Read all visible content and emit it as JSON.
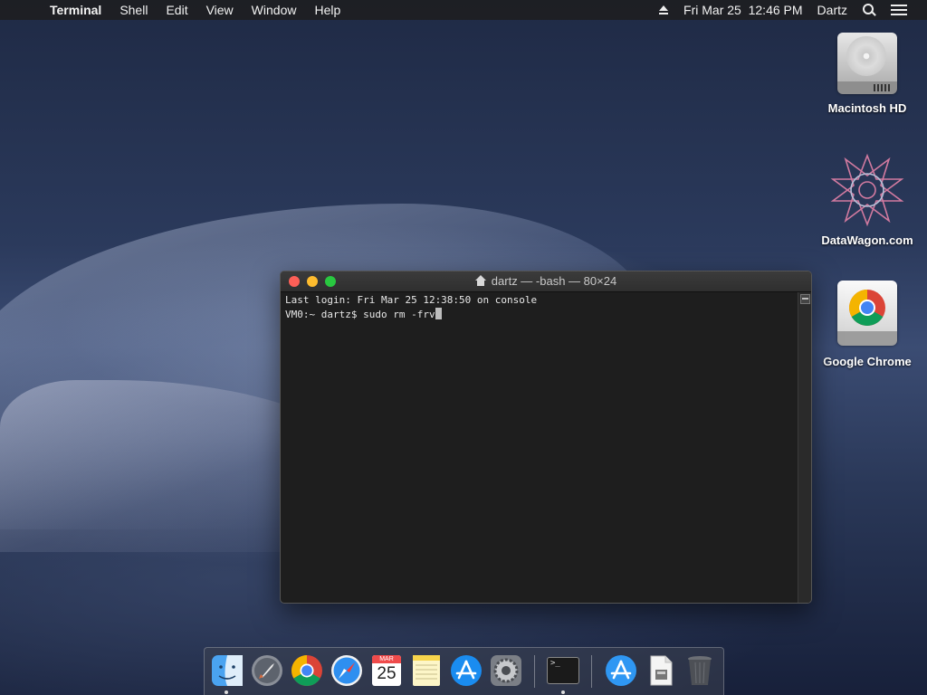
{
  "menubar": {
    "apple_glyph": "",
    "app_name": "Terminal",
    "menus": [
      "Shell",
      "Edit",
      "View",
      "Window",
      "Help"
    ],
    "clock": "Fri Mar 25  12:46 PM",
    "user": "Dartz"
  },
  "desktop_icons": [
    {
      "label": "Macintosh HD",
      "icon": "hard-drive-icon"
    },
    {
      "label": "DataWagon.com",
      "icon": "star-pattern-icon"
    },
    {
      "label": "Google Chrome",
      "icon": "chrome-disk-icon"
    }
  ],
  "terminal": {
    "title": "dartz — -bash — 80×24",
    "lines": [
      "Last login: Fri Mar 25 12:38:50 on console",
      "VM0:~ dartz$ sudo rm -frv"
    ]
  },
  "dock": {
    "calendar_month": "MAR",
    "calendar_day": "25",
    "terminal_prompt": ">_",
    "items": [
      "finder-icon",
      "launchpad-icon",
      "chrome-icon",
      "safari-icon",
      "calendar-icon",
      "notes-icon",
      "app-store-icon",
      "system-preferences-icon",
      "terminal-icon",
      "app-store-downloads-icon",
      "document-icon",
      "trash-icon"
    ]
  },
  "colors": {
    "close": "#fd5f57",
    "minimize": "#febc2e",
    "zoom": "#29c840",
    "terminal_bg": "#1e1e1e"
  }
}
